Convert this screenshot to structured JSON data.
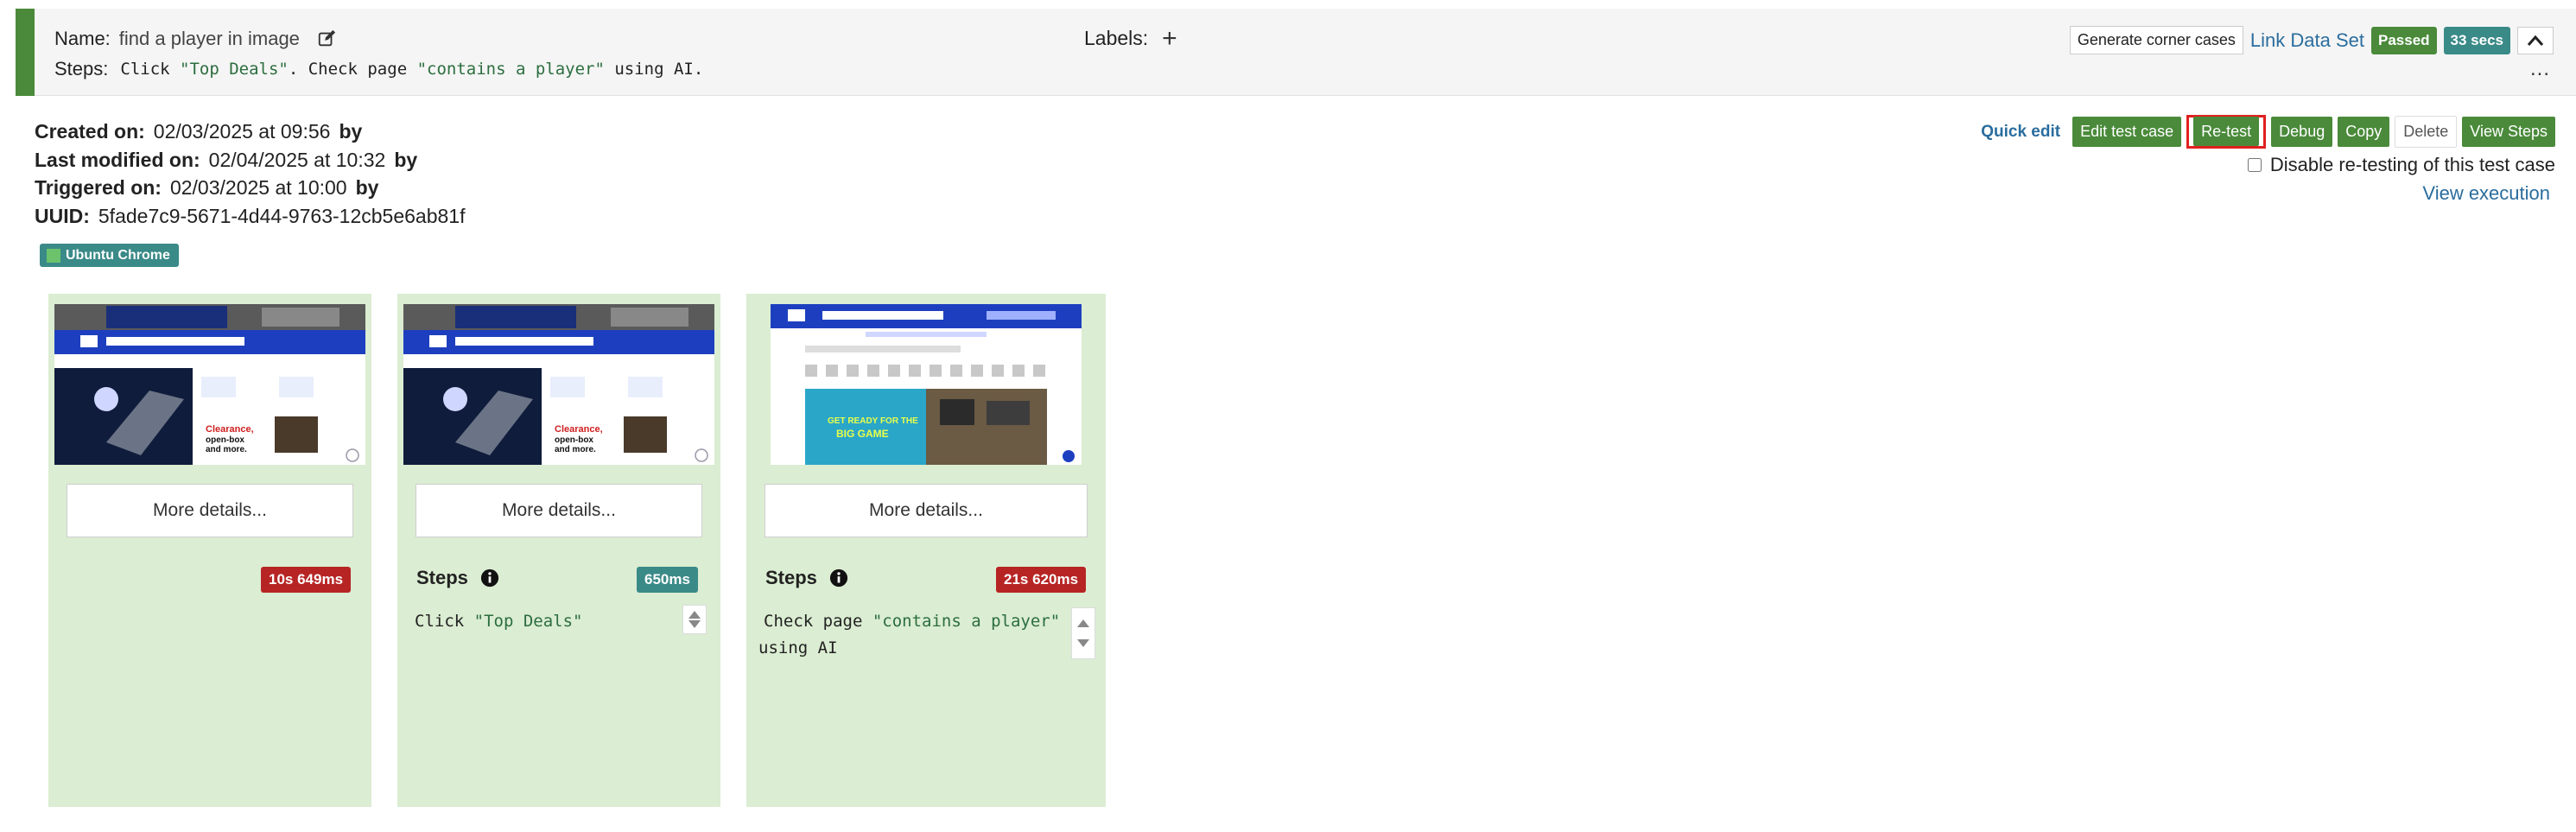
{
  "header": {
    "name_label": "Name:",
    "name_value": "find a player in image",
    "steps_label": "Steps:",
    "steps_code_1": "Click ",
    "steps_str_1": "\"Top Deals\"",
    "steps_code_2": ". Check page ",
    "steps_str_2": "\"contains a player\"",
    "steps_code_3": " using AI.",
    "labels_label": "Labels:",
    "add_label_icon": "plus-icon",
    "generate_corner_cases": "Generate corner cases",
    "link_data_set": "Link Data Set",
    "status": "Passed",
    "duration": "33 secs",
    "more": "...",
    "colors": {
      "status_bar": "#4a8a3a",
      "passed": "#4a8a3a",
      "duration": "#3a8a88"
    }
  },
  "meta": {
    "created_label": "Created on:",
    "created_value": "02/03/2025 at 09:56",
    "modified_label": "Last modified on:",
    "modified_value": "02/04/2025 at 10:32",
    "triggered_label": "Triggered on:",
    "triggered_value": "02/03/2025 at 10:00",
    "by": "by",
    "uuid_label": "UUID:",
    "uuid_value": "5fade7c9-5671-4d44-9763-12cb5e6ab81f",
    "environment": "Ubuntu Chrome"
  },
  "toolbar": {
    "quick_edit": "Quick edit",
    "edit_test_case": "Edit test case",
    "retest": "Re-test",
    "debug": "Debug",
    "copy": "Copy",
    "delete": "Delete",
    "view_steps": "View Steps",
    "disable_retesting": "Disable re-testing of this test case",
    "view_execution": "View execution"
  },
  "cards": [
    {
      "more": "More details...",
      "duration": "10s 649ms",
      "duration_color": "#b72424"
    },
    {
      "more": "More details...",
      "duration": "650ms",
      "duration_color": "#3a8a88",
      "steps_title": "Steps",
      "step_code": "Click ",
      "step_str": "\"Top Deals\""
    },
    {
      "more": "More details...",
      "duration": "21s 620ms",
      "duration_color": "#b72424",
      "steps_title": "Steps",
      "step_code": "Check page ",
      "step_str": "\"contains a player\"",
      "step_code_2": "using AI"
    }
  ]
}
